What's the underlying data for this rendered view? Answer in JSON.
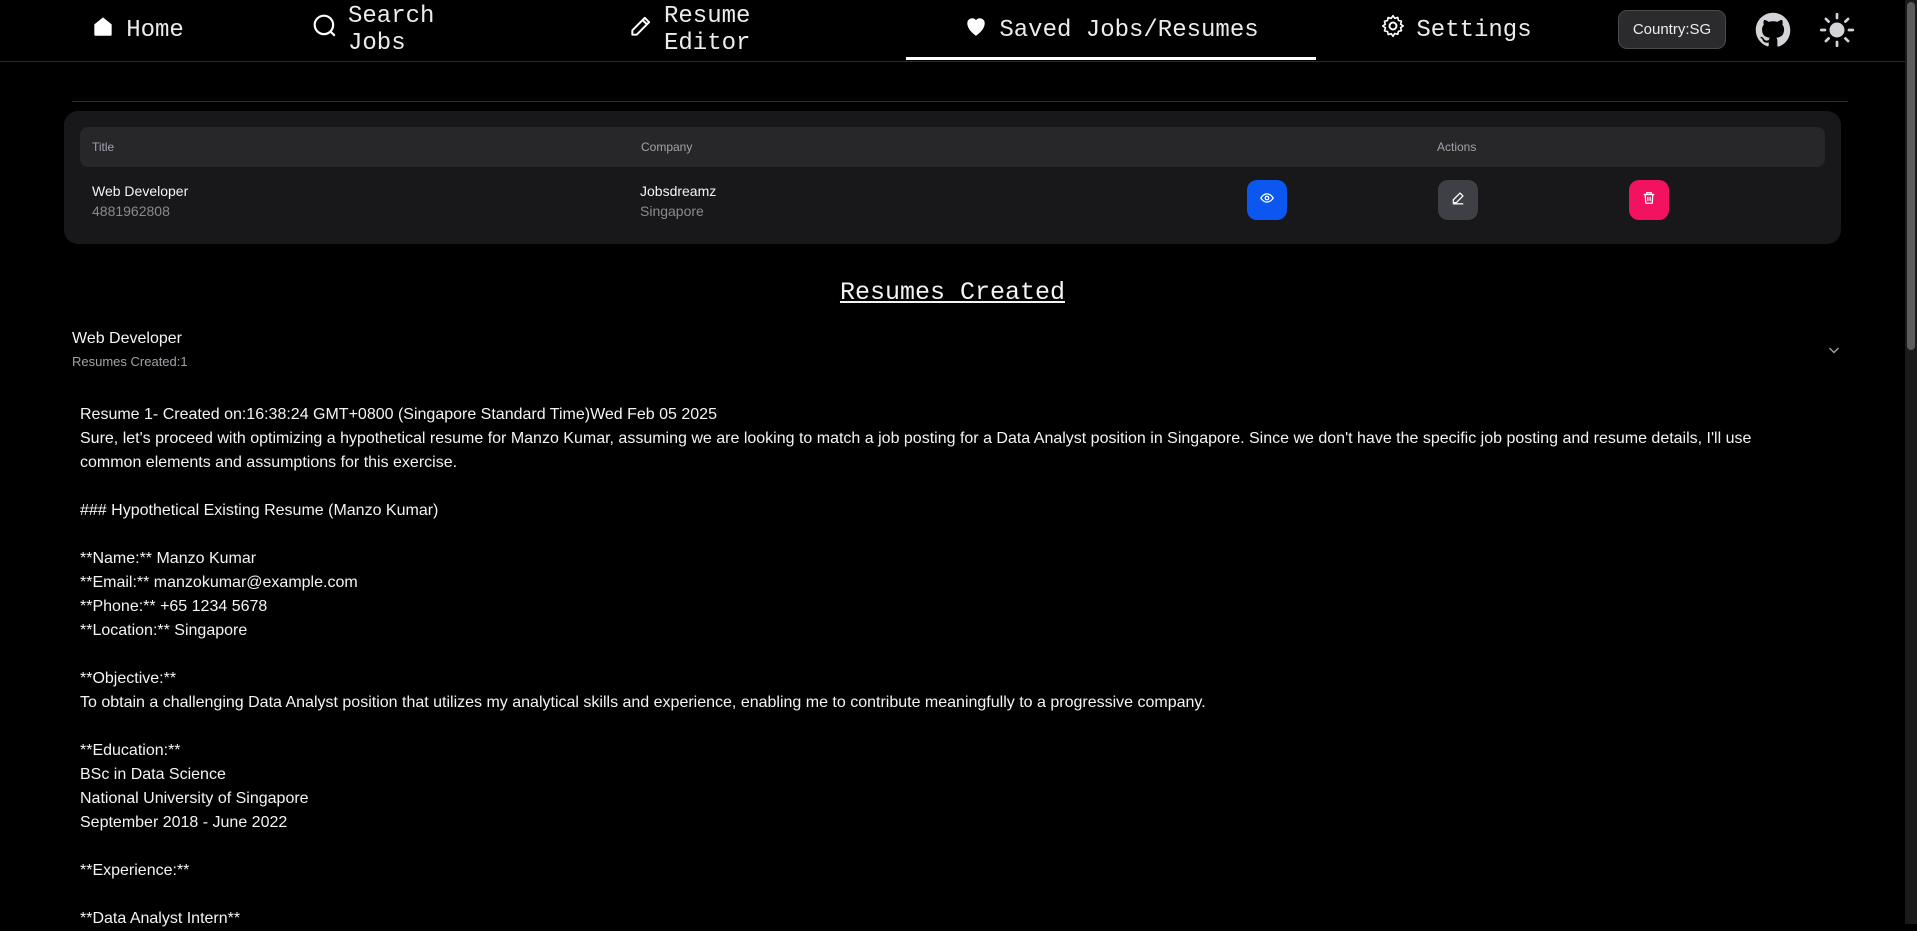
{
  "nav": {
    "items": [
      {
        "label": "Home",
        "icon": "home-icon"
      },
      {
        "label": "Search Jobs",
        "icon": "search-icon"
      },
      {
        "label": "Resume Editor",
        "icon": "pencil-icon"
      },
      {
        "label": "Saved Jobs/Resumes",
        "icon": "heart-icon",
        "active": true
      },
      {
        "label": "Settings",
        "icon": "gear-icon"
      }
    ],
    "country": "Country:SG",
    "github_icon": "github-icon",
    "theme_icon": "sun-icon"
  },
  "saved_jobs": {
    "columns": {
      "title": "Title",
      "company": "Company",
      "actions": "Actions"
    },
    "rows": [
      {
        "title": "Web Developer",
        "id": "4881962808",
        "company": "Jobsdreamz",
        "location": "Singapore"
      }
    ],
    "action_icons": [
      "eye-icon",
      "edit-icon",
      "trash-icon"
    ],
    "action_colors": {
      "view": "#0b57f0",
      "edit": "#3f3f46",
      "delete": "#f31260"
    }
  },
  "resumes": {
    "heading": "Resumes Created",
    "groups": [
      {
        "title": "Web Developer",
        "count_label": "Resumes Created:1",
        "content_lines": [
          "Resume 1- Created on:16:38:24 GMT+0800 (Singapore Standard Time)Wed Feb 05 2025",
          "Sure, let's proceed with optimizing a hypothetical resume for Manzo Kumar, assuming we are looking to match a job posting for a Data Analyst position in Singapore. Since we don't have the specific job posting and resume details, I'll use common elements and assumptions for this exercise.",
          "",
          "### Hypothetical Existing Resume (Manzo Kumar)",
          "",
          "**Name:** Manzo Kumar",
          "**Email:** manzokumar@example.com",
          "**Phone:** +65 1234 5678",
          "**Location:** Singapore",
          "",
          "**Objective:**",
          "To obtain a challenging Data Analyst position that utilizes my analytical skills and experience, enabling me to contribute meaningfully to a progressive company.",
          "",
          "**Education:**",
          "BSc in Data Science",
          "National University of Singapore",
          "September 2018 - June 2022",
          "",
          "**Experience:**",
          "",
          "**Data Analyst Intern**"
        ]
      }
    ]
  }
}
